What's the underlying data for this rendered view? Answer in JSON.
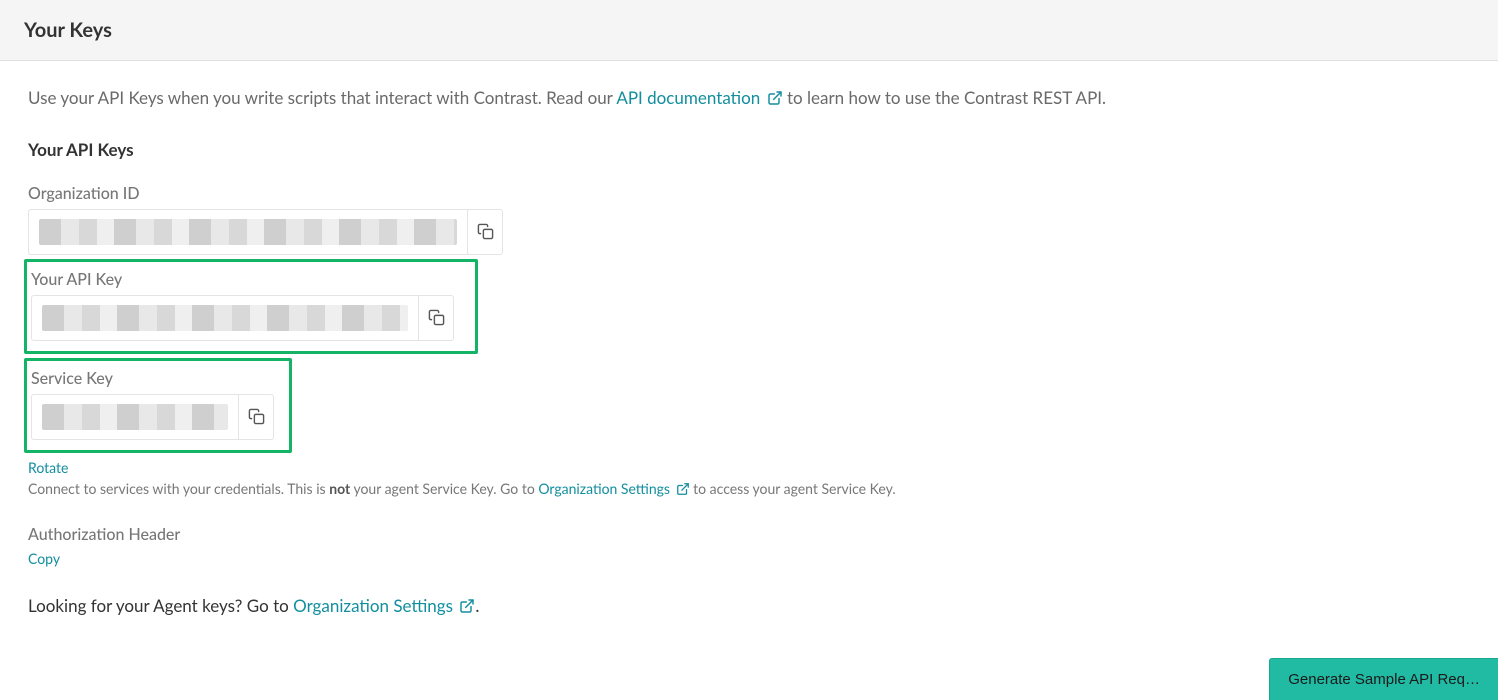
{
  "header": {
    "title": "Your Keys"
  },
  "intro": {
    "before": "Use your API Keys when you write scripts that interact with Contrast. Read our ",
    "link": "API documentation",
    "after": " to learn how to use the Contrast REST API."
  },
  "section_title": "Your API Keys",
  "fields": {
    "org_id": {
      "label": "Organization ID"
    },
    "api_key": {
      "label": "Your API Key"
    },
    "service_key": {
      "label": "Service Key"
    }
  },
  "rotate_link": "Rotate",
  "service_note": {
    "before": "Connect to services with your credentials. This is ",
    "bold": "not",
    "mid": " your agent Service Key. Go to ",
    "link": "Organization Settings",
    "after": " to access your agent Service Key."
  },
  "auth": {
    "label": "Authorization Header",
    "copy": "Copy"
  },
  "agent": {
    "before": "Looking for your Agent keys? Go to ",
    "link": "Organization Settings",
    "after": "."
  },
  "generate_button": "Generate Sample API Req…"
}
